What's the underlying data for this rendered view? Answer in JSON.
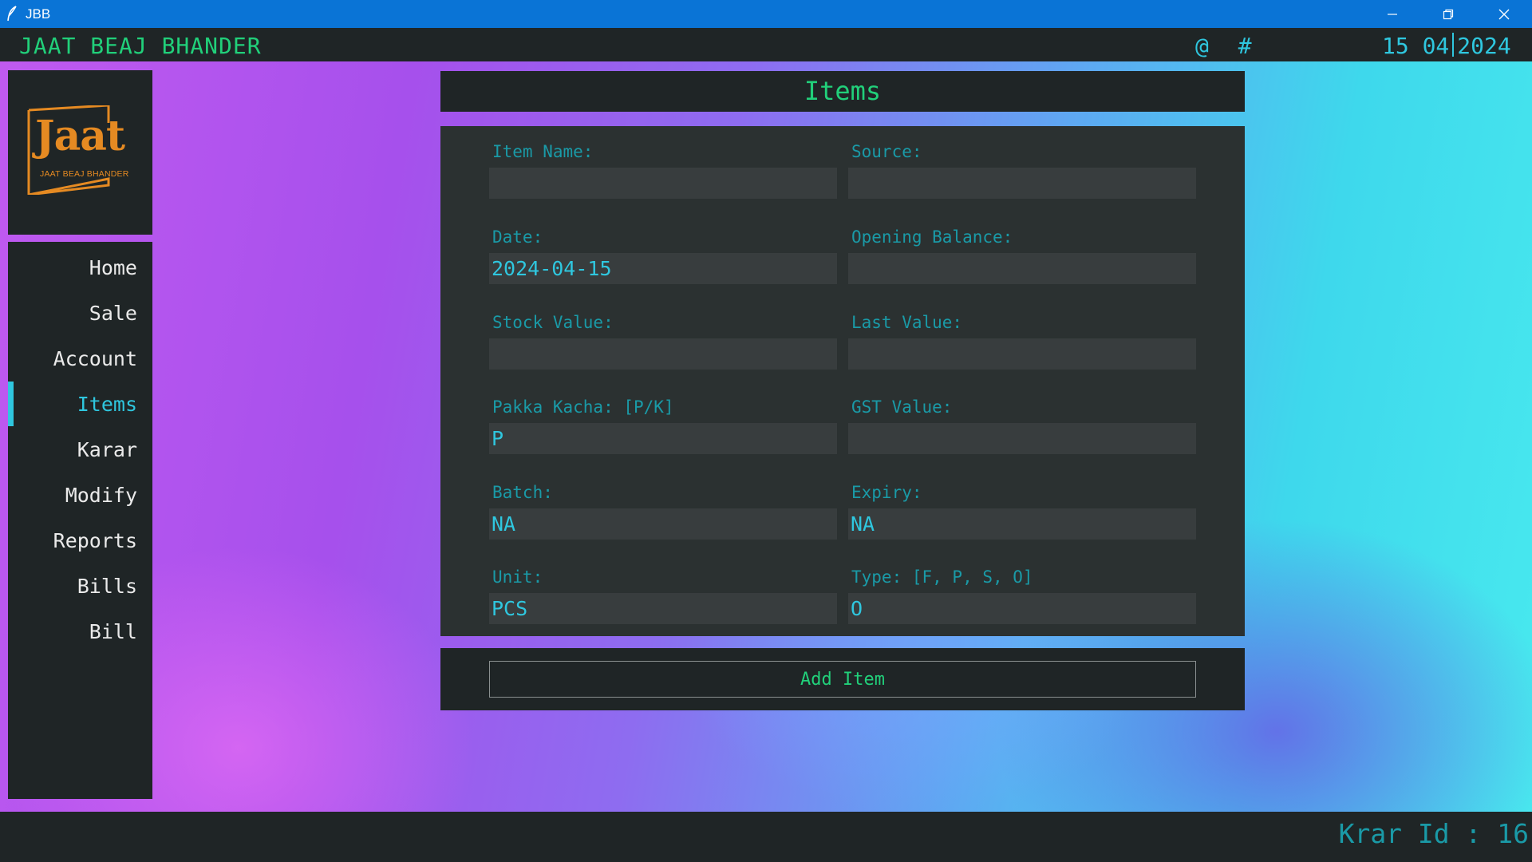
{
  "window": {
    "title": "JBB",
    "icon": "feather-icon"
  },
  "header": {
    "app_name": "JAAT BEAJ BHANDER",
    "icons": "@ #",
    "date_day_month": "15 04",
    "date_year": "2024"
  },
  "logo": {
    "word": "Jaat",
    "sub": "JAAT BEAJ BHANDER",
    "color": "#e58a22"
  },
  "sidebar": {
    "active": "Items",
    "items": [
      {
        "label": "Home"
      },
      {
        "label": "Sale"
      },
      {
        "label": "Account"
      },
      {
        "label": "Items"
      },
      {
        "label": "Karar"
      },
      {
        "label": "Modify"
      },
      {
        "label": "Reports"
      },
      {
        "label": "Bills"
      },
      {
        "label": "Bill"
      }
    ]
  },
  "page": {
    "title": "Items"
  },
  "form": {
    "item_name": {
      "label": "Item Name:",
      "value": ""
    },
    "source": {
      "label": "Source:",
      "value": ""
    },
    "date": {
      "label": "Date:",
      "value": "2024-04-15"
    },
    "opening_balance": {
      "label": "Opening Balance:",
      "value": ""
    },
    "stock_value": {
      "label": "Stock Value:",
      "value": ""
    },
    "last_value": {
      "label": "Last Value:",
      "value": ""
    },
    "pakka_kacha": {
      "label": "Pakka Kacha: [P/K]",
      "value": "P"
    },
    "gst_value": {
      "label": "GST Value:",
      "value": ""
    },
    "batch": {
      "label": "Batch:",
      "value": "NA"
    },
    "expiry": {
      "label": "Expiry:",
      "value": "NA"
    },
    "unit": {
      "label": "Unit:",
      "value": "PCS"
    },
    "type": {
      "label": "Type: [F, P, S, O]",
      "value": "O"
    }
  },
  "actions": {
    "add_item": "Add Item"
  },
  "status": {
    "krar_id": "Krar Id : 16"
  },
  "colors": {
    "accent_green": "#21d07a",
    "accent_cyan": "#2fc7df",
    "label_teal": "#1a9aa7",
    "panel": "#1f2526",
    "titlebar": "#0a74d6"
  }
}
